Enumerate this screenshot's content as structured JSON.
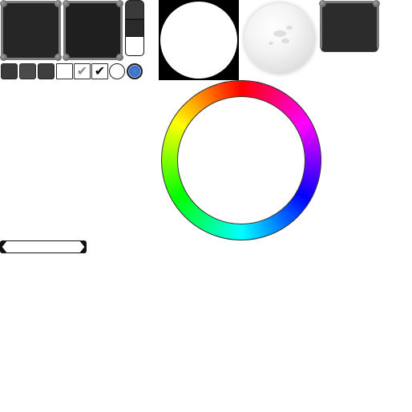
{
  "atlas": {
    "panels": [
      {
        "name": "panel-large-1"
      },
      {
        "name": "panel-large-2"
      },
      {
        "name": "panel-small"
      }
    ],
    "buttons": [
      {
        "name": "button-dark-normal"
      },
      {
        "name": "button-dark-hover"
      },
      {
        "name": "button-dark-pressed"
      }
    ],
    "checkboxes": [
      {
        "state": "unchecked",
        "glyph": ""
      },
      {
        "state": "checked-disabled",
        "glyph": "✔",
        "color": "#8a8a8a"
      },
      {
        "state": "checked",
        "glyph": "✔",
        "color": "#000000"
      }
    ],
    "radios": [
      {
        "state": "off"
      },
      {
        "state": "on",
        "color": "#3d6fc4"
      }
    ],
    "hue_ring": {
      "colors": [
        "#ff0000",
        "#ff00ff",
        "#0000ff",
        "#00ffff",
        "#00ff00",
        "#ffff00"
      ]
    },
    "colors": {
      "panel_bg": "#262626",
      "corner": "#7a7a7a",
      "accent_blue": "#3d6fc4",
      "black": "#000000",
      "white": "#ffffff"
    }
  }
}
